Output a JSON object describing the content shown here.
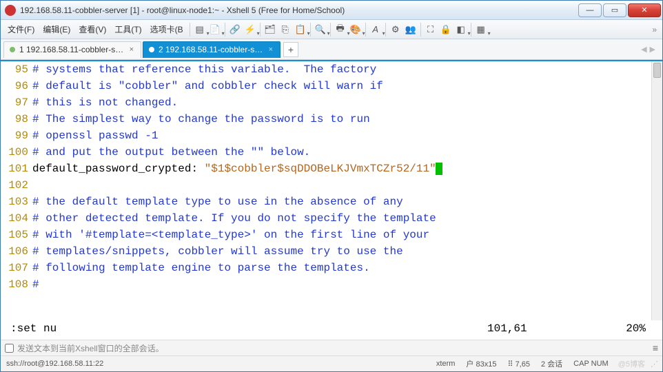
{
  "window": {
    "title": "192.168.58.11-cobbler-server [1] - root@linux-node1:~ - Xshell 5 (Free for Home/School)"
  },
  "menu": {
    "file": "文件(F)",
    "edit": "编辑(E)",
    "view": "查看(V)",
    "tools": "工具(T)",
    "tabs": "选项卡(B"
  },
  "tabs": {
    "t1": "1 192.168.58.11-cobbler-server...",
    "t2": "2 192.168.58.11-cobbler-ser...",
    "add": "+"
  },
  "code": {
    "lines": [
      {
        "n": "95",
        "cls": "comment",
        "t": "# systems that reference this variable.  The factory"
      },
      {
        "n": "96",
        "cls": "comment",
        "t": "# default is \"cobbler\" and cobbler check will warn if"
      },
      {
        "n": "97",
        "cls": "comment",
        "t": "# this is not changed."
      },
      {
        "n": "98",
        "cls": "comment",
        "t": "# The simplest way to change the password is to run"
      },
      {
        "n": "99",
        "cls": "comment",
        "t": "# openssl passwd -1"
      },
      {
        "n": "100",
        "cls": "comment",
        "t": "# and put the output between the \"\" below."
      },
      {
        "n": "101",
        "cls": "kv",
        "k": "default_password_crypted: ",
        "v": "\"$1$cobbler$sqDDOBeLKJVmxTCZr52/11\""
      },
      {
        "n": "102",
        "cls": "blank",
        "t": ""
      },
      {
        "n": "103",
        "cls": "comment",
        "t": "# the default template type to use in the absence of any"
      },
      {
        "n": "104",
        "cls": "comment",
        "t": "# other detected template. If you do not specify the template"
      },
      {
        "n": "105",
        "cls": "comment",
        "t": "# with '#template=<template_type>' on the first line of your"
      },
      {
        "n": "106",
        "cls": "comment",
        "t": "# templates/snippets, cobbler will assume try to use the"
      },
      {
        "n": "107",
        "cls": "comment",
        "t": "# following template engine to parse the templates."
      },
      {
        "n": "108",
        "cls": "comment",
        "t": "#"
      }
    ]
  },
  "vim_status": {
    "cmd": ":set nu",
    "pos": "101,61",
    "pct": "20%"
  },
  "broadcast": {
    "label": "发送文本到当前Xshell窗口的全部会话。"
  },
  "statusbar": {
    "conn": "ssh://root@192.168.58.11:22",
    "term": "xterm",
    "size": "⼾ 83x15",
    "enc": "⠿  7,65",
    "sessions": "2 会话",
    "caps": "CAP  NUM",
    "watermark": "@5​​​博客"
  }
}
